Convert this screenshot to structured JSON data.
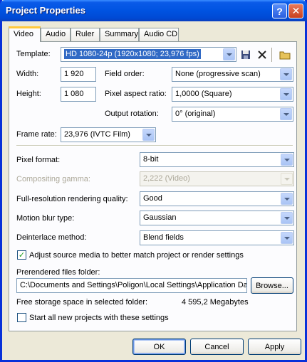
{
  "window": {
    "title": "Project Properties"
  },
  "tabs": [
    {
      "label": "Video"
    },
    {
      "label": "Audio"
    },
    {
      "label": "Ruler"
    },
    {
      "label": "Summary"
    },
    {
      "label": "Audio CD"
    }
  ],
  "template": {
    "label": "Template:",
    "value": "HD 1080-24p (1920x1080; 23,976 fps)"
  },
  "width": {
    "label": "Width:",
    "value": "1 920"
  },
  "height": {
    "label": "Height:",
    "value": "1 080"
  },
  "field_order": {
    "label": "Field order:",
    "value": "None (progressive scan)"
  },
  "pixel_aspect": {
    "label": "Pixel aspect ratio:",
    "value": "1,0000 (Square)"
  },
  "output_rotation": {
    "label": "Output rotation:",
    "value": "0° (original)"
  },
  "frame_rate": {
    "label": "Frame rate:",
    "value": "23,976 (IVTC Film)"
  },
  "pixel_format": {
    "label": "Pixel format:",
    "value": "8-bit"
  },
  "compositing_gamma": {
    "label": "Compositing gamma:",
    "value": "2,222 (Video)"
  },
  "render_quality": {
    "label": "Full-resolution rendering quality:",
    "value": "Good"
  },
  "motion_blur": {
    "label": "Motion blur type:",
    "value": "Gaussian"
  },
  "deinterlace": {
    "label": "Deinterlace method:",
    "value": "Blend fields"
  },
  "adjust_source": {
    "label": "Adjust source media to better match project or render settings",
    "checked": true
  },
  "prerendered": {
    "label": "Prerendered files folder:",
    "value": "C:\\Documents and Settings\\Poligon\\Local Settings\\Application Da",
    "browse": "Browse..."
  },
  "free_space": {
    "label": "Free storage space in selected folder:",
    "value": "4 595,2 Megabytes"
  },
  "start_new": {
    "label": "Start all new projects with these settings",
    "checked": false
  },
  "buttons": {
    "ok": "OK",
    "cancel": "Cancel",
    "apply": "Apply"
  },
  "colors": {
    "titlebar": "#0054e3",
    "selection": "#316ac5",
    "tab_accent": "#ffc83c"
  }
}
